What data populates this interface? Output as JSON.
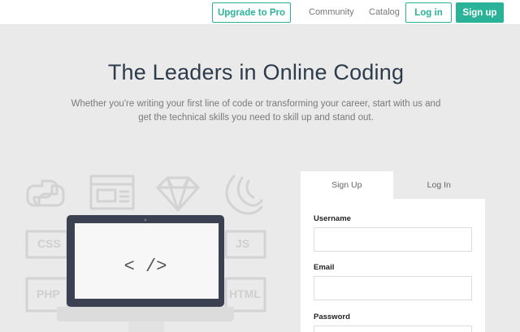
{
  "nav": {
    "upgrade_label": "Upgrade to Pro",
    "community_label": "Community",
    "catalog_label": "Catalog",
    "login_label": "Log in",
    "signup_label": "Sign up"
  },
  "hero": {
    "title": "The Leaders in Online Coding",
    "subtitle_line1": "Whether you're writing your first line of code or transforming your career, start with us and",
    "subtitle_line2": "get the technical skills you need to skill up and stand out."
  },
  "illustration": {
    "laptop_code": "<  />",
    "badges": [
      "CSS",
      "JS",
      "PHP",
      "HTML"
    ],
    "icons": [
      "python-icon",
      "browser-icon",
      "ruby-gem-icon",
      "sass-icon"
    ]
  },
  "form": {
    "tabs": [
      {
        "label": "Sign Up",
        "active": true
      },
      {
        "label": "Log In",
        "active": false
      }
    ],
    "fields": [
      {
        "label": "Username",
        "value": "",
        "placeholder": ""
      },
      {
        "label": "Email",
        "value": "",
        "placeholder": ""
      },
      {
        "label": "Password",
        "value": "",
        "placeholder": ""
      }
    ]
  },
  "colors": {
    "accent": "#2bb39a",
    "page_bg": "#eaeaea",
    "title": "#2d3b4b",
    "decor_stroke": "#d3d3d3"
  }
}
